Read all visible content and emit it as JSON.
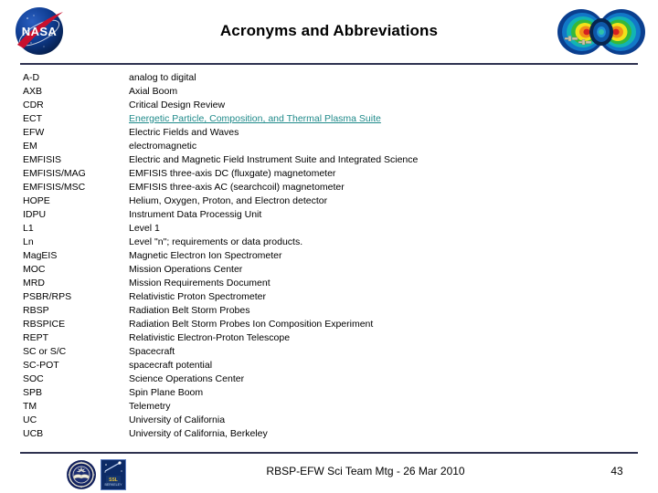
{
  "header": {
    "title": "Acronyms and Abbreviations",
    "left_logo": "nasa-meatball-logo",
    "right_logo": "rbsp-radiation-belt-logo"
  },
  "colors": {
    "rule": "#2e3250",
    "link": "#1f8a8a",
    "text": "#000000",
    "background": "#ffffff",
    "nasa_blue": "#0b3d91",
    "nasa_red": "#c8102e"
  },
  "acronyms": [
    {
      "term": "A-D",
      "definition": "analog to digital",
      "is_link": false
    },
    {
      "term": "AXB",
      "definition": "Axial Boom",
      "is_link": false
    },
    {
      "term": "CDR",
      "definition": "Critical Design Review",
      "is_link": false
    },
    {
      "term": "ECT",
      "definition": "Energetic Particle, Composition, and Thermal Plasma Suite",
      "is_link": true
    },
    {
      "term": "EFW",
      "definition": "Electric Fields and Waves",
      "is_link": false
    },
    {
      "term": "EM",
      "definition": "electromagnetic",
      "is_link": false
    },
    {
      "term": "EMFISIS",
      "definition": "Electric and Magnetic Field Instrument Suite and Integrated Science",
      "is_link": false
    },
    {
      "term": "EMFISIS/MAG",
      "definition": "EMFISIS three-axis DC (fluxgate) magnetometer",
      "is_link": false
    },
    {
      "term": "EMFISIS/MSC",
      "definition": "EMFISIS three-axis AC (searchcoil) magnetometer",
      "is_link": false
    },
    {
      "term": "HOPE",
      "definition": "Helium, Oxygen, Proton, and Electron detector",
      "is_link": false
    },
    {
      "term": "IDPU",
      "definition": "Instrument Data Processig Unit",
      "is_link": false
    },
    {
      "term": "L1",
      "definition": "Level 1",
      "is_link": false
    },
    {
      "term": "Ln",
      "definition": "Level \"n\"; requirements or data products.",
      "is_link": false
    },
    {
      "term": "MagEIS",
      "definition": "Magnetic Electron Ion Spectrometer",
      "is_link": false
    },
    {
      "term": "MOC",
      "definition": "Mission Operations Center",
      "is_link": false
    },
    {
      "term": "MRD",
      "definition": "Mission Requirements Document",
      "is_link": false
    },
    {
      "term": "PSBR/RPS",
      "definition": "Relativistic Proton Spectrometer",
      "is_link": false
    },
    {
      "term": "RBSP",
      "definition": "Radiation Belt Storm Probes",
      "is_link": false
    },
    {
      "term": "RBSPICE",
      "definition": "Radiation Belt Storm Probes Ion Composition Experiment",
      "is_link": false
    },
    {
      "term": "REPT",
      "definition": "Relativistic Electron-Proton Telescope",
      "is_link": false
    },
    {
      "term": "SC or S/C",
      "definition": "Spacecraft",
      "is_link": false
    },
    {
      "term": "SC-POT",
      "definition": "spacecraft potential",
      "is_link": false
    },
    {
      "term": "SOC",
      "definition": "Science Operations Center",
      "is_link": false
    },
    {
      "term": "SPB",
      "definition": "Spin Plane Boom",
      "is_link": false
    },
    {
      "term": "TM",
      "definition": "Telemetry",
      "is_link": false
    },
    {
      "term": "UC",
      "definition": "University of California",
      "is_link": false
    },
    {
      "term": "UCB",
      "definition": "University of California, Berkeley",
      "is_link": false
    }
  ],
  "footer": {
    "text": "RBSP-EFW Sci Team Mtg - 26 Mar 2010",
    "page_number": "43",
    "logos": [
      "uc-berkeley-seal-logo",
      "space-sciences-lab-logo"
    ]
  }
}
